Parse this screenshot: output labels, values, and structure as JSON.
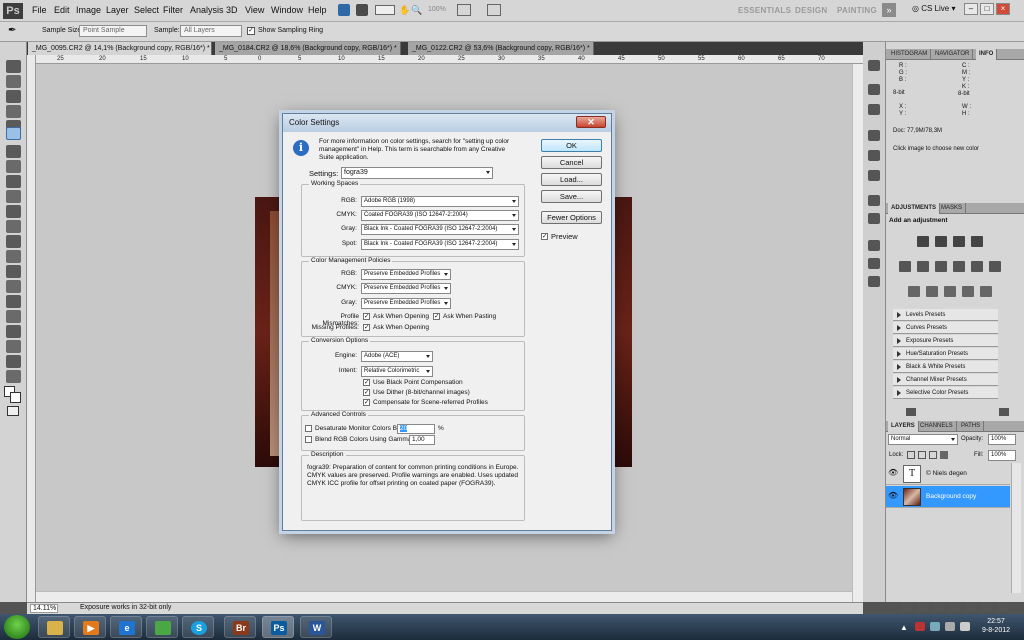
{
  "menubar": {
    "logo": "Ps",
    "items": [
      "File",
      "Edit",
      "Image",
      "Layer",
      "Select",
      "Filter",
      "Analysis",
      "3D",
      "View",
      "Window",
      "Help"
    ],
    "zoom": "100%",
    "workspaces": [
      "ESSENTIALS",
      "DESIGN",
      "PAINTING"
    ],
    "cs_live": "CS Live"
  },
  "options_bar": {
    "sample_size_label": "Sample Size:",
    "sample_size_value": "Point Sample",
    "sample_label": "Sample:",
    "sample_value": "All Layers",
    "show_ring_label": "Show Sampling Ring"
  },
  "doc_tabs": [
    {
      "label": "_MG_0095.CR2 @ 14,1% (Background copy, RGB/16*) *"
    },
    {
      "label": "_MG_0184.CR2 @ 18,6% (Background copy, RGB/16*) *"
    },
    {
      "label": "_MG_0122.CR2 @ 53,6% (Background copy, RGB/16*) *"
    }
  ],
  "ruler_numbers": [
    "25",
    "20",
    "15",
    "10",
    "5",
    "0",
    "5",
    "10",
    "15",
    "20",
    "25",
    "30",
    "35",
    "40",
    "45",
    "50",
    "55",
    "60",
    "65",
    "70"
  ],
  "status": {
    "zoom": "14.11%",
    "text": "Exposure works in 32-bit only"
  },
  "dialog": {
    "title": "Color Settings",
    "info_text": "For more information on color settings, search for \"setting up color management\" in Help. This term is searchable from any Creative Suite application.",
    "settings_label": "Settings:",
    "settings_value": "fogra39",
    "buttons": {
      "ok": "OK",
      "cancel": "Cancel",
      "load": "Load...",
      "save": "Save...",
      "fewer": "Fewer Options"
    },
    "preview_label": "Preview",
    "working_spaces": {
      "legend": "Working Spaces",
      "rgb_label": "RGB:",
      "rgb": "Adobe RGB (1998)",
      "cmyk_label": "CMYK:",
      "cmyk": "Coated FOGRA39 (ISO 12647-2:2004)",
      "gray_label": "Gray:",
      "gray": "Black Ink - Coated FOGRA39 (ISO 12647-2:2004)",
      "spot_label": "Spot:",
      "spot": "Black Ink - Coated FOGRA39 (ISO 12647-2:2004)"
    },
    "policies": {
      "legend": "Color Management Policies",
      "rgb_label": "RGB:",
      "rgb": "Preserve Embedded Profiles",
      "cmyk_label": "CMYK:",
      "cmyk": "Preserve Embedded Profiles",
      "gray_label": "Gray:",
      "gray": "Preserve Embedded Profiles",
      "mismatch_label": "Profile Mismatches:",
      "ask_opening": "Ask When Opening",
      "ask_pasting": "Ask When Pasting",
      "missing_label": "Missing Profiles:",
      "ask_opening_missing": "Ask When Opening"
    },
    "conversion": {
      "legend": "Conversion Options",
      "engine_label": "Engine:",
      "engine": "Adobe (ACE)",
      "intent_label": "Intent:",
      "intent": "Relative Colorimetric",
      "bpc": "Use Black Point Compensation",
      "dither": "Use Dither (8-bit/channel images)",
      "compensate": "Compensate for Scene-referred Profiles"
    },
    "advanced": {
      "legend": "Advanced Controls",
      "desaturate": "Desaturate Monitor Colors By:",
      "desaturate_value": "20",
      "percent": "%",
      "blend": "Blend RGB Colors Using Gamma:",
      "blend_value": "1,00"
    },
    "description": {
      "legend": "Description",
      "text": "fogra39:  Preparation of content for common printing conditions in Europe. CMYK values are preserved. Profile warnings are enabled. Uses updated CMYK ICC profile for offset printing on coated paper (FOGRA39)."
    }
  },
  "panels": {
    "info_tabs": [
      "HISTOGRAM",
      "NAVIGATOR",
      "INFO"
    ],
    "info": {
      "r": "R :",
      "g": "G :",
      "b": "B :",
      "bit1": "8-bit",
      "c": "C :",
      "m": "M :",
      "y": "Y :",
      "k": "K :",
      "bit2": "8-bit",
      "x": "X :",
      "y2": "Y :",
      "w": "W :",
      "h": "H :",
      "doc": "Doc: 77,9M/78,3M",
      "hint": "Click image to choose new color"
    },
    "adj_tabs": [
      "ADJUSTMENTS",
      "MASKS"
    ],
    "add_adjustment": "Add an adjustment",
    "presets": [
      "Levels Presets",
      "Curves Presets",
      "Exposure Presets",
      "Hue/Saturation Presets",
      "Black & White Presets",
      "Channel Mixer Presets",
      "Selective Color Presets"
    ],
    "layers_tabs": [
      "LAYERS",
      "CHANNELS",
      "PATHS"
    ],
    "blend_mode": "Normal",
    "opacity_label": "Opacity:",
    "opacity": "100%",
    "lock_label": "Lock:",
    "fill_label": "Fill:",
    "fill": "100%",
    "layers": [
      {
        "name": "© Niels degen",
        "thumb": "T"
      },
      {
        "name": "Background copy"
      }
    ]
  },
  "taskbar": {
    "time": "22:57",
    "date": "9-8-2012",
    "ps": "Ps",
    "br": "Br",
    "w": "W"
  },
  "colors": {
    "accent": "#3399ff",
    "ps_blue": "#0b5c9e",
    "layer_selected": "#3399ff"
  }
}
